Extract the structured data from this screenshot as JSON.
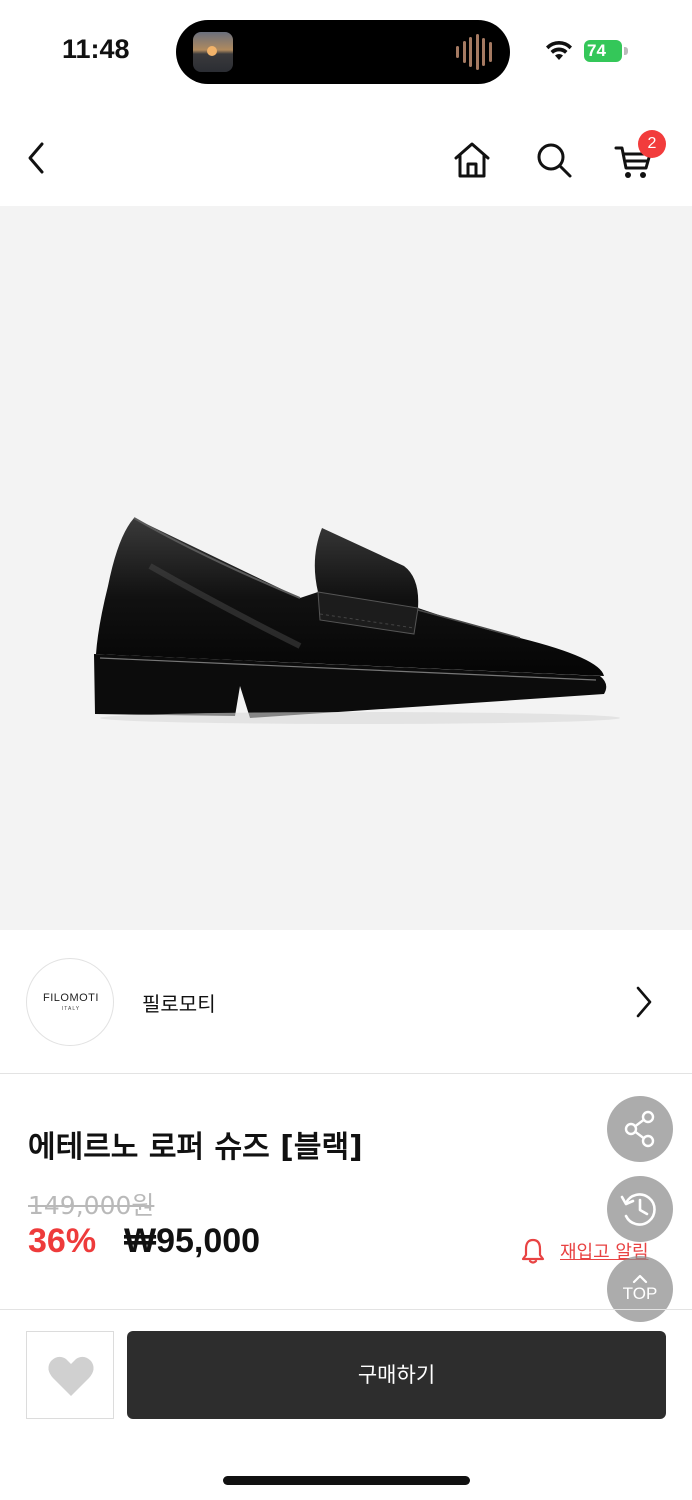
{
  "status_bar": {
    "time": "11:48",
    "battery": "74"
  },
  "nav": {
    "back_icon": "chevron-left-icon",
    "home_icon": "home-icon",
    "search_icon": "search-icon",
    "cart_icon": "cart-icon",
    "cart_count": "2"
  },
  "product_image": {
    "subject": "black penny loafer shoe"
  },
  "brand": {
    "logo_text": "FILOMOTI",
    "logo_subtext": "ITALY",
    "name": "필로모티"
  },
  "product": {
    "title": "에테르노 로퍼 슈즈 [블랙]",
    "original_price": "149,000원",
    "discount_rate": "36%",
    "sale_price": "₩95,000",
    "restock_label": "재입고 알림"
  },
  "floating": {
    "top_label": "TOP"
  },
  "actions": {
    "buy_label": "구매하기"
  },
  "colors": {
    "accent_red": "#ee3b3b",
    "buy_button": "#2d2d2d",
    "badge": "#f23c3c"
  }
}
